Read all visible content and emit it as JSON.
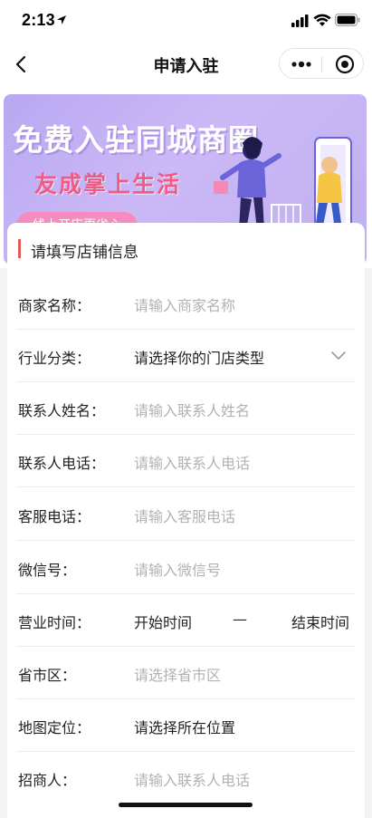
{
  "status_bar": {
    "time": "2:13"
  },
  "nav": {
    "title": "申请入驻"
  },
  "banner": {
    "title": "免费入驻同城商圈",
    "subtitle": "友成掌上生活",
    "pill": "线上开店更省心"
  },
  "section": {
    "title": "请填写店铺信息"
  },
  "form": {
    "rows": [
      {
        "label": "商家名称：",
        "value": "请输入商家名称"
      },
      {
        "label": "行业分类：",
        "value": "请选择你的门店类型"
      },
      {
        "label": "联系人姓名：",
        "value": "请输入联系人姓名"
      },
      {
        "label": "联系人电话：",
        "value": "请输入联系人电话"
      },
      {
        "label": "客服电话：",
        "value": "请输入客服电话"
      },
      {
        "label": "微信号：",
        "value": "请输入微信号"
      },
      {
        "label": "营业时间：",
        "start": "开始时间",
        "dash": "—",
        "end": "结束时间"
      },
      {
        "label": "省市区：",
        "value": "请选择省市区"
      },
      {
        "label": "地图定位：",
        "value": "请选择所在位置"
      },
      {
        "label": "招商人：",
        "value": "请输入联系人电话"
      }
    ]
  },
  "colors": {
    "accent_bar": "#e25a5a",
    "placeholder": "#b2b2b2",
    "banner_bg": "#c0b0f2",
    "banner_sub": "#f25a86"
  }
}
